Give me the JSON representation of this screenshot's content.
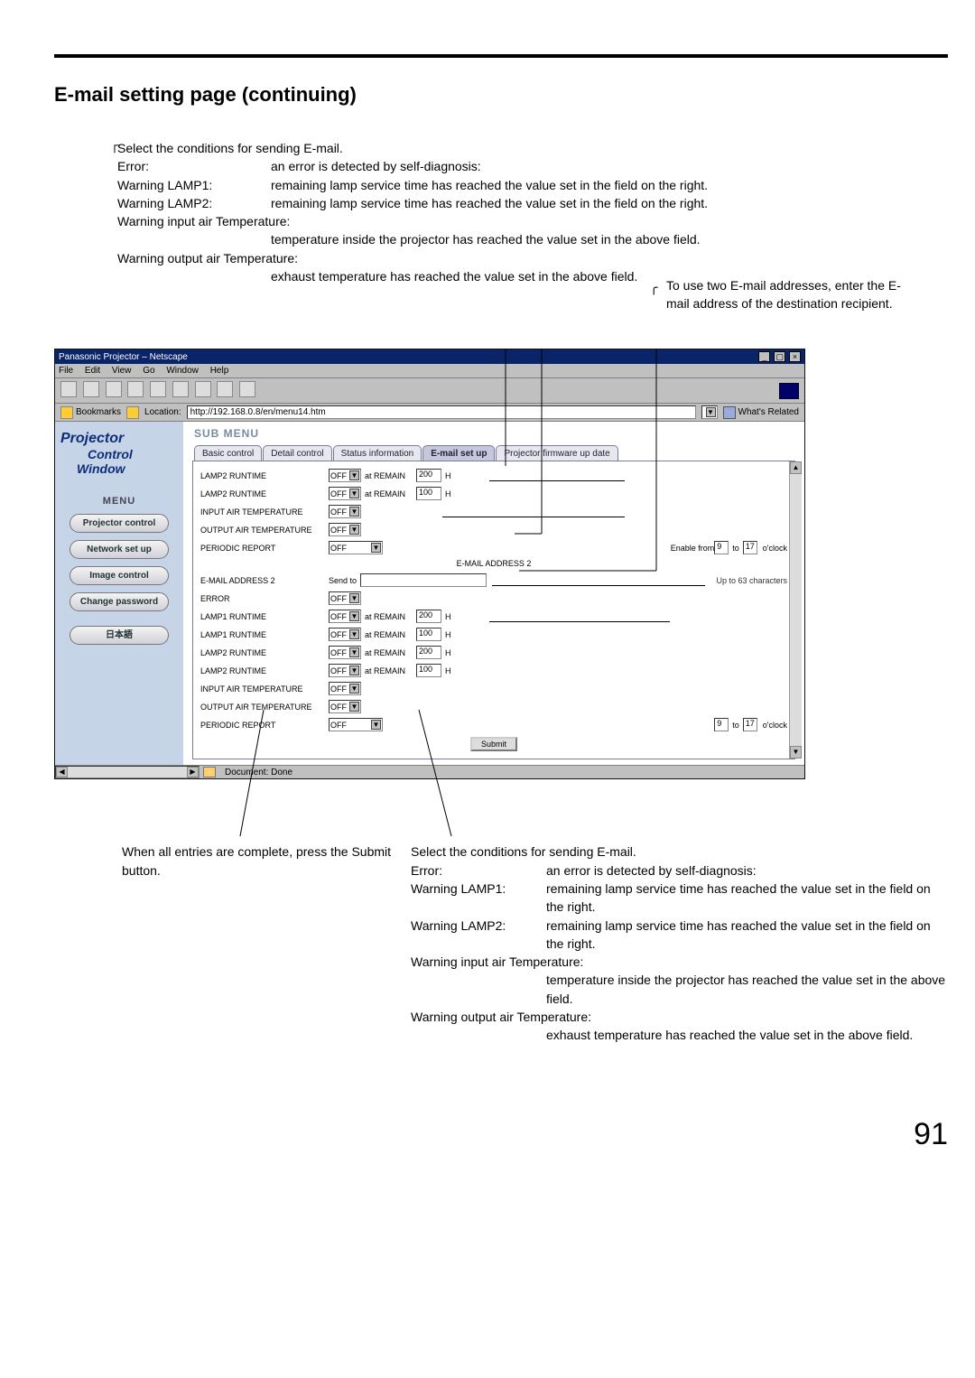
{
  "section_title": "E-mail setting page (continuing)",
  "page_number": "91",
  "top_callout": {
    "intro": "Select the conditions for sending E-mail.",
    "rows": [
      {
        "k": "Error:",
        "v": "an error is detected by self-diagnosis:"
      },
      {
        "k": "Warning LAMP1:",
        "v": "remaining lamp service time has reached the value set in the field on the right."
      },
      {
        "k": "Warning LAMP2:",
        "v": "remaining lamp service time has reached the value set in the field on the right."
      },
      {
        "k": "Warning input air Temperature:",
        "v": "temperature inside the projector has reached the value set in the above field."
      },
      {
        "k": "Warning output air Temperature:",
        "v": "exhaust temperature has reached the value set in the above field."
      }
    ]
  },
  "right_note": "To use two E-mail addresses, enter the E-mail address of the destination recipient.",
  "browser": {
    "title": "Panasonic Projector – Netscape",
    "menubar": [
      "File",
      "Edit",
      "View",
      "Go",
      "Window",
      "Help"
    ],
    "location_label": "Bookmarks",
    "location_value": "http://192.168.0.8/en/menu14.htm",
    "whats_related": "What's Related",
    "status": "Document: Done"
  },
  "sidebar": {
    "logo": {
      "l1": "Projector",
      "l2": "Control",
      "l3": "Window"
    },
    "menu_title": "MENU",
    "buttons": [
      "Projector control",
      "Network set up",
      "Image control",
      "Change password",
      "日本語"
    ]
  },
  "submenu": {
    "title": "SUB MENU",
    "tabs": [
      "Basic control",
      "Detail control",
      "Status information",
      "E-mail set up",
      "Projector firmware up date"
    ],
    "active_index": 3
  },
  "form": {
    "rows1": [
      {
        "label": "LAMP2 RUNTIME",
        "sel": "OFF",
        "text_before": "at REMAIN",
        "val": "200",
        "unit": "H"
      },
      {
        "label": "LAMP2 RUNTIME",
        "sel": "OFF",
        "text_before": "at REMAIN",
        "val": "100",
        "unit": "H"
      },
      {
        "label": "INPUT AIR TEMPERATURE",
        "sel": "OFF"
      },
      {
        "label": "OUTPUT AIR TEMPERATURE",
        "sel": "OFF"
      }
    ],
    "periodic1": {
      "label": "PERIODIC REPORT",
      "sel": "OFF",
      "from_lbl": "Enable from",
      "from": "9",
      "to_lbl": "to",
      "to": "17",
      "oclock": "o'clock"
    },
    "header2": "E-MAIL ADDRESS 2",
    "sendto": {
      "label": "E-MAIL ADDRESS 2",
      "field_label": "Send to",
      "val": "",
      "note": "Up to 63 characters"
    },
    "rows2": [
      {
        "label": "ERROR",
        "sel": "OFF"
      },
      {
        "label": "LAMP1 RUNTIME",
        "sel": "OFF",
        "text_before": "at REMAIN",
        "val": "200",
        "unit": "H"
      },
      {
        "label": "LAMP1 RUNTIME",
        "sel": "OFF",
        "text_before": "at REMAIN",
        "val": "100",
        "unit": "H"
      },
      {
        "label": "LAMP2 RUNTIME",
        "sel": "OFF",
        "text_before": "at REMAIN",
        "val": "200",
        "unit": "H"
      },
      {
        "label": "LAMP2 RUNTIME",
        "sel": "OFF",
        "text_before": "at REMAIN",
        "val": "100",
        "unit": "H"
      },
      {
        "label": "INPUT AIR TEMPERATURE",
        "sel": "OFF"
      },
      {
        "label": "OUTPUT AIR TEMPERATURE",
        "sel": "OFF"
      }
    ],
    "periodic2": {
      "label": "PERIODIC REPORT",
      "sel": "OFF",
      "from": "9",
      "to_lbl": "to",
      "to": "17",
      "oclock": "o'clock"
    },
    "submit": "Submit"
  },
  "bottom_left": "When all entries are complete, press the Submit button.",
  "bottom_right": {
    "intro": "Select the conditions for sending E-mail.",
    "rows": [
      {
        "k": "Error:",
        "v": "an error is detected by self-diagnosis:"
      },
      {
        "k": "Warning LAMP1:",
        "v": "remaining lamp service time has reached the value set in the field on the right."
      },
      {
        "k": "Warning LAMP2:",
        "v": "remaining lamp service time has reached the value set in the field on the right."
      },
      {
        "k": "Warning input air Temperature:",
        "v": "temperature inside the projector has reached the value set in the above field."
      },
      {
        "k": "Warning output air Temperature:",
        "v": "exhaust temperature has reached the value set in the above field."
      }
    ]
  }
}
